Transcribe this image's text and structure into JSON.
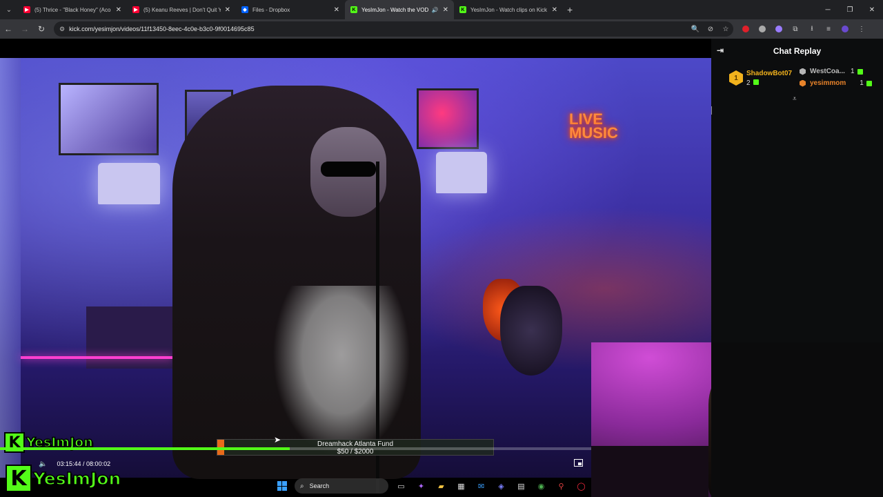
{
  "browser": {
    "tabs": [
      {
        "title": "(5) Thrice - \"Black Honey\" (Aco",
        "favicon_color": "#ff0033",
        "active": false
      },
      {
        "title": "(5) Keanu Reeves | Don't Quit Y",
        "favicon_color": "#ff0033",
        "active": false
      },
      {
        "title": "Files - Dropbox",
        "favicon_color": "#0061ff",
        "active": false
      },
      {
        "title": "YesImJon - Watch the VOD",
        "favicon_color": "#53fc18",
        "active": true
      },
      {
        "title": "YesImJon - Watch clips on Kick",
        "favicon_color": "#53fc18",
        "active": false
      }
    ],
    "url": "kick.com/yesimjon/videos/11f13450-8eec-4c0e-b3c0-9f0014695c85"
  },
  "video": {
    "sign_line1": "LIVE",
    "sign_line2": "MUSIC",
    "brand_name": "YesImJon",
    "brand_logo_letter": "K",
    "goal": {
      "title": "Dreamhack Atlanta Fund",
      "amount": "$50 / $2000",
      "progress": 0.025
    },
    "playback": {
      "current": "03:15:44",
      "separator": "/",
      "duration": "08:00:02",
      "progress": 0.49
    }
  },
  "chat": {
    "title": "Chat Replay",
    "leaderboard": {
      "first": {
        "rank": "1",
        "name": "ShadowBot07",
        "count": "2"
      },
      "second": {
        "name": "WestCoa...",
        "count": "1"
      },
      "third": {
        "name": "yesimmom",
        "count": "1"
      }
    }
  },
  "taskbar": {
    "search_label": "Search"
  },
  "colors": {
    "kick_green": "#53fc18",
    "gold": "#f2b21d",
    "bronze": "#e8832a",
    "silver": "#b5b5b5"
  }
}
